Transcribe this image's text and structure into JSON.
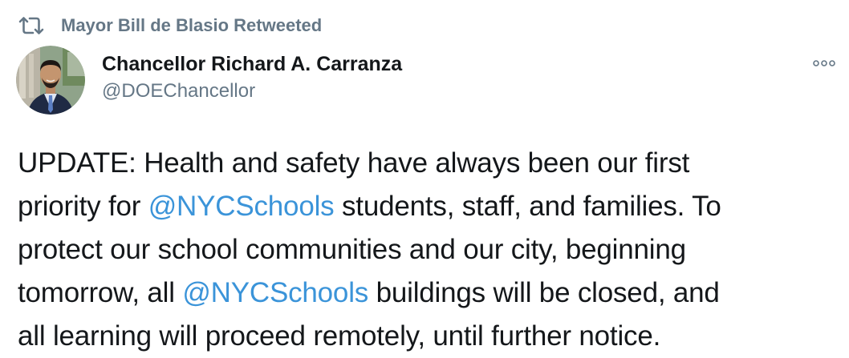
{
  "retweet": {
    "icon": "retweet-icon",
    "label": "Mayor Bill de Blasio Retweeted"
  },
  "author": {
    "avatar": "avatar-photo",
    "name": "Chancellor Richard A. Carranza",
    "handle": "@DOEChancellor"
  },
  "more_icon": "more-options-icon",
  "tweet": {
    "line1": "UPDATE: Health and safety have always been our first",
    "line2_pre": "priority for ",
    "mention1": "@NYCSchools",
    "line2_post": " students, staff, and families. To",
    "line3": "protect our school communities and our city, beginning",
    "line4_pre": "tomorrow, all ",
    "mention2": "@NYCSchools",
    "line4_post": " buildings will be closed, and",
    "line5": "all learning will proceed remotely, until further notice."
  },
  "colors": {
    "text": "#14171a",
    "secondary": "#657786",
    "mention": "#3b94d9"
  }
}
